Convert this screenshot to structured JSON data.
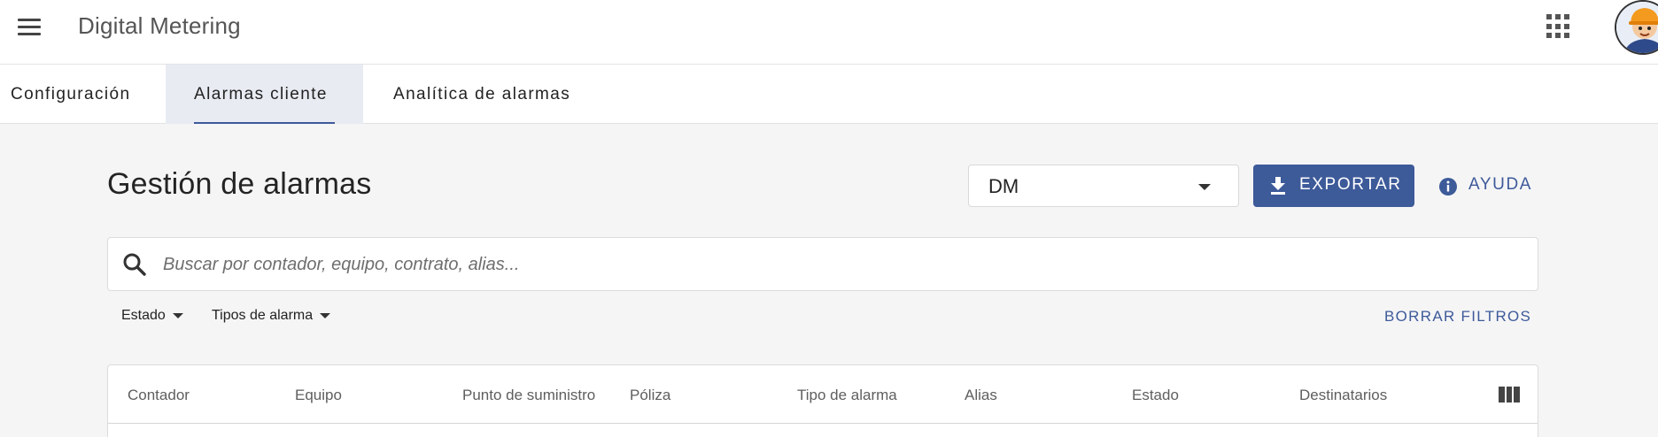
{
  "header": {
    "app_title": "Digital Metering",
    "menu_icon": "hamburger-menu-icon",
    "apps_icon": "apps-grid-icon",
    "avatar": "user-avatar"
  },
  "tabs": [
    {
      "label": "Configuración",
      "active": false
    },
    {
      "label": "Alarmas cliente",
      "active": true
    },
    {
      "label": "Analítica de alarmas",
      "active": false
    }
  ],
  "page": {
    "title": "Gestión de alarmas",
    "selector_value": "DM",
    "export_label": "EXPORTAR",
    "help_label": "AYUDA"
  },
  "search": {
    "placeholder": "Buscar por contador, equipo, contrato, alias..."
  },
  "filters": {
    "status_label": "Estado",
    "alarm_types_label": "Tipos de alarma",
    "clear_label": "BORRAR FILTROS"
  },
  "table": {
    "columns": [
      "Contador",
      "Equipo",
      "Punto de suministro",
      "Póliza",
      "Tipo de alarma",
      "Alias",
      "Estado",
      "Destinatarios"
    ]
  },
  "colors": {
    "primary": "#3d5a99",
    "active_tab_bg": "#e9ebf3",
    "page_bg": "#f5f5f6"
  }
}
